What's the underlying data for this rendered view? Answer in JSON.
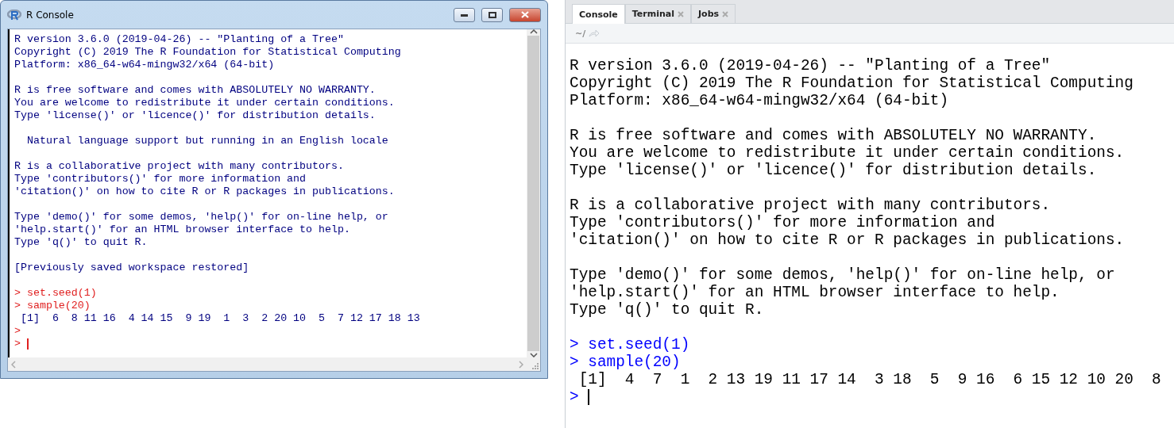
{
  "r_console": {
    "title": "R Console",
    "blocks": [
      {
        "lines": [
          {
            "kind": "output",
            "text": "R version 3.6.0 (2019-04-26) -- \"Planting of a Tree\""
          },
          {
            "kind": "output",
            "text": "Copyright (C) 2019 The R Foundation for Statistical Computing"
          },
          {
            "kind": "output",
            "text": "Platform: x86_64-w64-mingw32/x64 (64-bit)"
          }
        ]
      },
      {
        "lines": [
          {
            "kind": "output",
            "text": "R is free software and comes with ABSOLUTELY NO WARRANTY."
          },
          {
            "kind": "output",
            "text": "You are welcome to redistribute it under certain conditions."
          },
          {
            "kind": "output",
            "text": "Type 'license()' or 'licence()' for distribution details."
          }
        ]
      },
      {
        "lines": [
          {
            "kind": "output",
            "text": "  Natural language support but running in an English locale"
          }
        ]
      },
      {
        "lines": [
          {
            "kind": "output",
            "text": "R is a collaborative project with many contributors."
          },
          {
            "kind": "output",
            "text": "Type 'contributors()' for more information and"
          },
          {
            "kind": "output",
            "text": "'citation()' on how to cite R or R packages in publications."
          }
        ]
      },
      {
        "lines": [
          {
            "kind": "output",
            "text": "Type 'demo()' for some demos, 'help()' for on-line help, or"
          },
          {
            "kind": "output",
            "text": "'help.start()' for an HTML browser interface to help."
          },
          {
            "kind": "output",
            "text": "Type 'q()' to quit R."
          }
        ]
      },
      {
        "lines": [
          {
            "kind": "output",
            "text": "[Previously saved workspace restored]"
          }
        ]
      },
      {
        "lines": [
          {
            "kind": "command",
            "prompt": ">",
            "text": "set.seed(1)"
          },
          {
            "kind": "command",
            "prompt": ">",
            "text": "sample(20)"
          },
          {
            "kind": "output",
            "text": " [1]  6  8 11 16  4 14 15  9 19  1  3  2 20 10  5  7 12 17 18 13"
          },
          {
            "kind": "command",
            "prompt": ">"
          },
          {
            "kind": "input",
            "prompt": ">"
          }
        ]
      }
    ]
  },
  "rstudio_console": {
    "tabs": [
      {
        "label": "Console",
        "selected": true,
        "closable": false
      },
      {
        "label": "Terminal",
        "selected": false,
        "closable": true
      },
      {
        "label": "Jobs",
        "selected": false,
        "closable": true
      }
    ],
    "path": "~/",
    "blocks": [
      {
        "lines": [
          {
            "kind": "output",
            "text": "R version 3.6.0 (2019-04-26) -- \"Planting of a Tree\""
          },
          {
            "kind": "output",
            "text": "Copyright (C) 2019 The R Foundation for Statistical Computing"
          },
          {
            "kind": "output",
            "text": "Platform: x86_64-w64-mingw32/x64 (64-bit)"
          }
        ]
      },
      {
        "lines": [
          {
            "kind": "output",
            "text": "R is free software and comes with ABSOLUTELY NO WARRANTY."
          },
          {
            "kind": "output",
            "text": "You are welcome to redistribute it under certain conditions."
          },
          {
            "kind": "output",
            "text": "Type 'license()' or 'licence()' for distribution details."
          }
        ]
      },
      {
        "lines": [
          {
            "kind": "output",
            "text": "R is a collaborative project with many contributors."
          },
          {
            "kind": "output",
            "text": "Type 'contributors()' for more information and"
          },
          {
            "kind": "output",
            "text": "'citation()' on how to cite R or R packages in publications."
          }
        ]
      },
      {
        "lines": [
          {
            "kind": "output",
            "text": "Type 'demo()' for some demos, 'help()' for on-line help, or"
          },
          {
            "kind": "output",
            "text": "'help.start()' for an HTML browser interface to help."
          },
          {
            "kind": "output",
            "text": "Type 'q()' to quit R."
          }
        ]
      },
      {
        "lines": [
          {
            "kind": "command",
            "prompt": ">",
            "text": "set.seed(1)"
          },
          {
            "kind": "command",
            "prompt": ">",
            "text": "sample(20)"
          },
          {
            "kind": "output",
            "text": " [1]  4  7  1  2 13 19 11 17 14  3 18  5  9 16  6 15 12 10 20  8"
          },
          {
            "kind": "input",
            "prompt": ">"
          }
        ]
      }
    ]
  }
}
